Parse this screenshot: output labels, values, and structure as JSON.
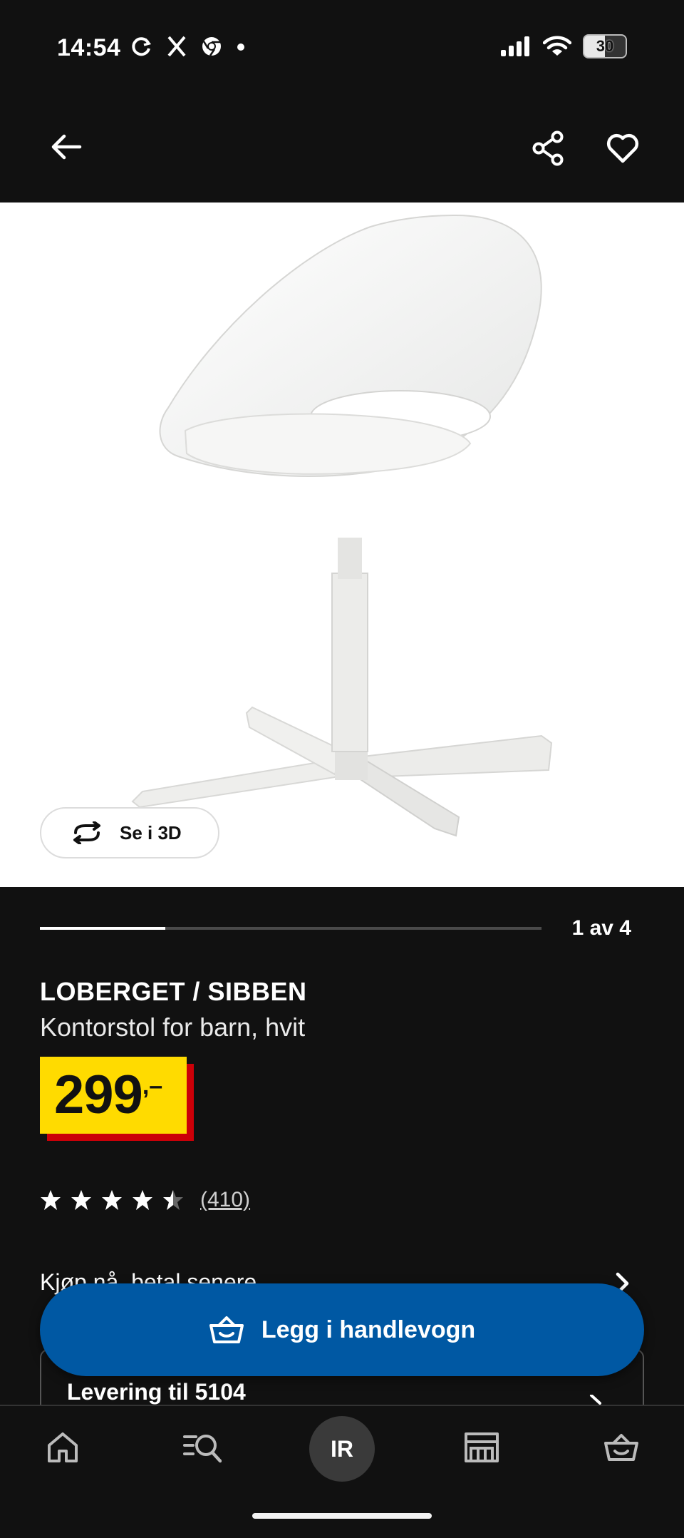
{
  "status_bar": {
    "time": "14:54",
    "left_icons": [
      "sync-icon",
      "x-icon",
      "chrome-icon",
      "dot-icon"
    ],
    "right_icons": [
      "signal-icon",
      "wifi-icon"
    ],
    "battery": "30"
  },
  "header": {
    "back_icon": "arrow-left-icon",
    "share_icon": "share-icon",
    "favorite_icon": "heart-icon"
  },
  "gallery": {
    "view_3d_label": "Se i 3D",
    "view_3d_icon": "rotate-icon",
    "position_label": "1 av 4",
    "progress_fraction": 0.25
  },
  "product": {
    "name": "LOBERGET / SIBBEN",
    "description": "Kontorstol for barn, hvit",
    "price": "299",
    "price_suffix": ",–",
    "rating": 4.5,
    "rating_max": 5,
    "review_count": "(410)"
  },
  "payment": {
    "bnpl_label": "Kjøp nå, betal senere"
  },
  "delivery": {
    "title": "Levering til 5104"
  },
  "cart": {
    "label": "Legg i handlevogn",
    "icon": "basket-icon"
  },
  "bottom_nav": {
    "items": [
      "home-icon",
      "search-list-icon",
      "profile",
      "store-icon",
      "basket-icon"
    ],
    "profile_initials": "IR"
  },
  "colors": {
    "background": "#111111",
    "accent_blue": "#0058a3",
    "price_yellow": "#ffdb00",
    "price_red": "#cc0008"
  }
}
